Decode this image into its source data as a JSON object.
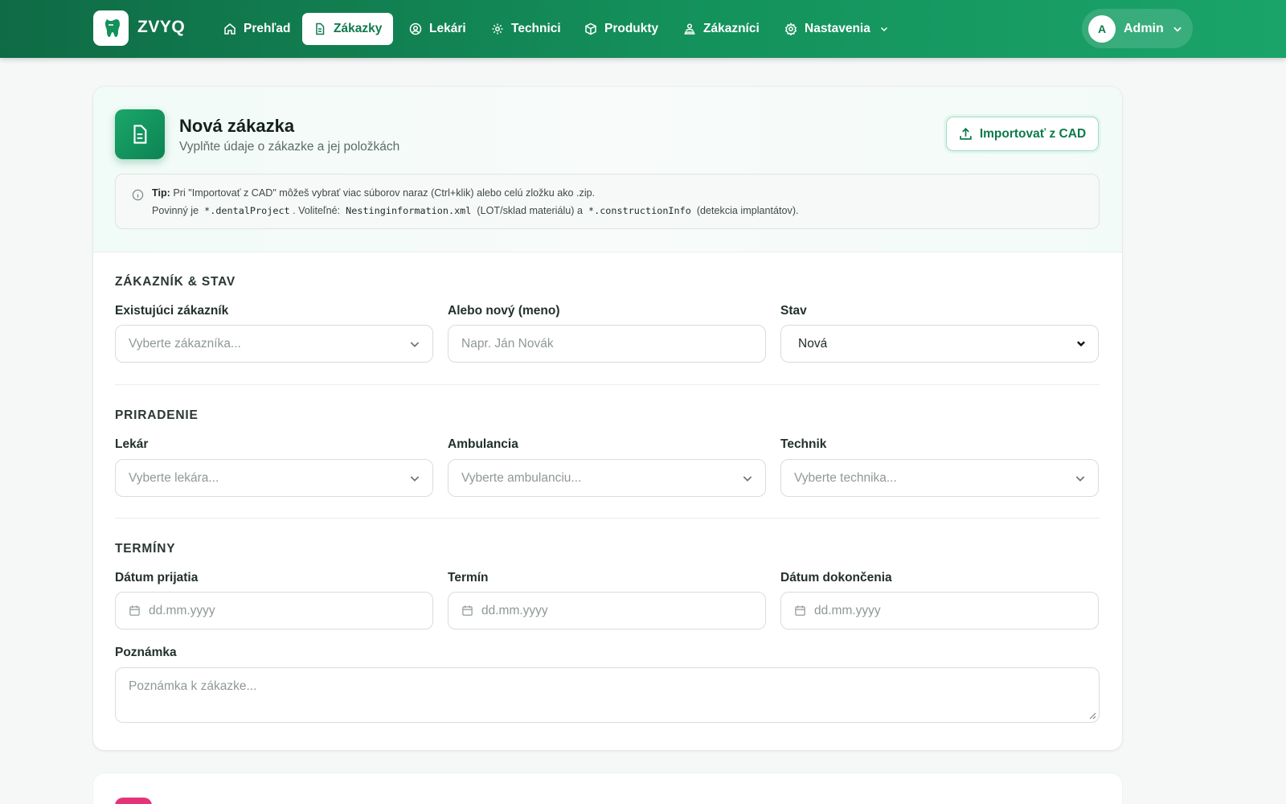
{
  "app": {
    "brand": "ZVYQ"
  },
  "nav": {
    "items": [
      {
        "label": "Prehľad",
        "icon": "home-icon"
      },
      {
        "label": "Zákazky",
        "icon": "document-icon",
        "active": true
      },
      {
        "label": "Lekári",
        "icon": "user-circle-icon"
      },
      {
        "label": "Technici",
        "icon": "gear-icon"
      },
      {
        "label": "Produkty",
        "icon": "box-icon"
      },
      {
        "label": "Zákazníci",
        "icon": "people-icon"
      },
      {
        "label": "Nastavenia",
        "icon": "settings-icon"
      }
    ],
    "user": {
      "initial": "A",
      "name": "Admin"
    }
  },
  "header": {
    "title": "Nová zákazka",
    "subtitle": "Vyplňte údaje o zákazke a jej položkách",
    "import_label": "Importovať z CAD"
  },
  "tip": {
    "bold": "Tip:",
    "line1": "Pri \"Importovať z CAD\" môžeš vybrať viac súborov naraz (Ctrl+klik) alebo celú zložku ako .zip.",
    "line2_a": "Povinný je",
    "code1": "*.dentalProject",
    "line2_b": ". Voliteľné:",
    "code2": "Nestinginformation.xml",
    "line2_c": "(LOT/sklad materiálu) a",
    "code3": "*.constructionInfo",
    "line2_d": "(detekcia implantátov)."
  },
  "sections": {
    "customer": {
      "title": "ZÁKAZNÍK & STAV",
      "existing_label": "Existujúci zákazník",
      "existing_placeholder": "Vyberte zákazníka...",
      "new_label": "Alebo nový (meno)",
      "new_placeholder": "Napr. Ján Novák",
      "status_label": "Stav",
      "status_value": "Nová"
    },
    "assignment": {
      "title": "PRIRADENIE",
      "doctor_label": "Lekár",
      "doctor_placeholder": "Vyberte lekára...",
      "clinic_label": "Ambulancia",
      "clinic_placeholder": "Vyberte ambulanciu...",
      "tech_label": "Technik",
      "tech_placeholder": "Vyberte technika..."
    },
    "dates": {
      "title": "TERMÍNY",
      "received_label": "Dátum prijatia",
      "received_placeholder": "dd.mm.yyyy",
      "due_label": "Termín",
      "due_placeholder": "dd.mm.yyyy",
      "done_label": "Dátum dokončenia",
      "done_placeholder": "dd.mm.yyyy",
      "note_label": "Poznámka",
      "note_placeholder": "Poznámka k zákazke..."
    }
  },
  "colors": {
    "primary": "#14925c",
    "accent": "#e5337a"
  }
}
